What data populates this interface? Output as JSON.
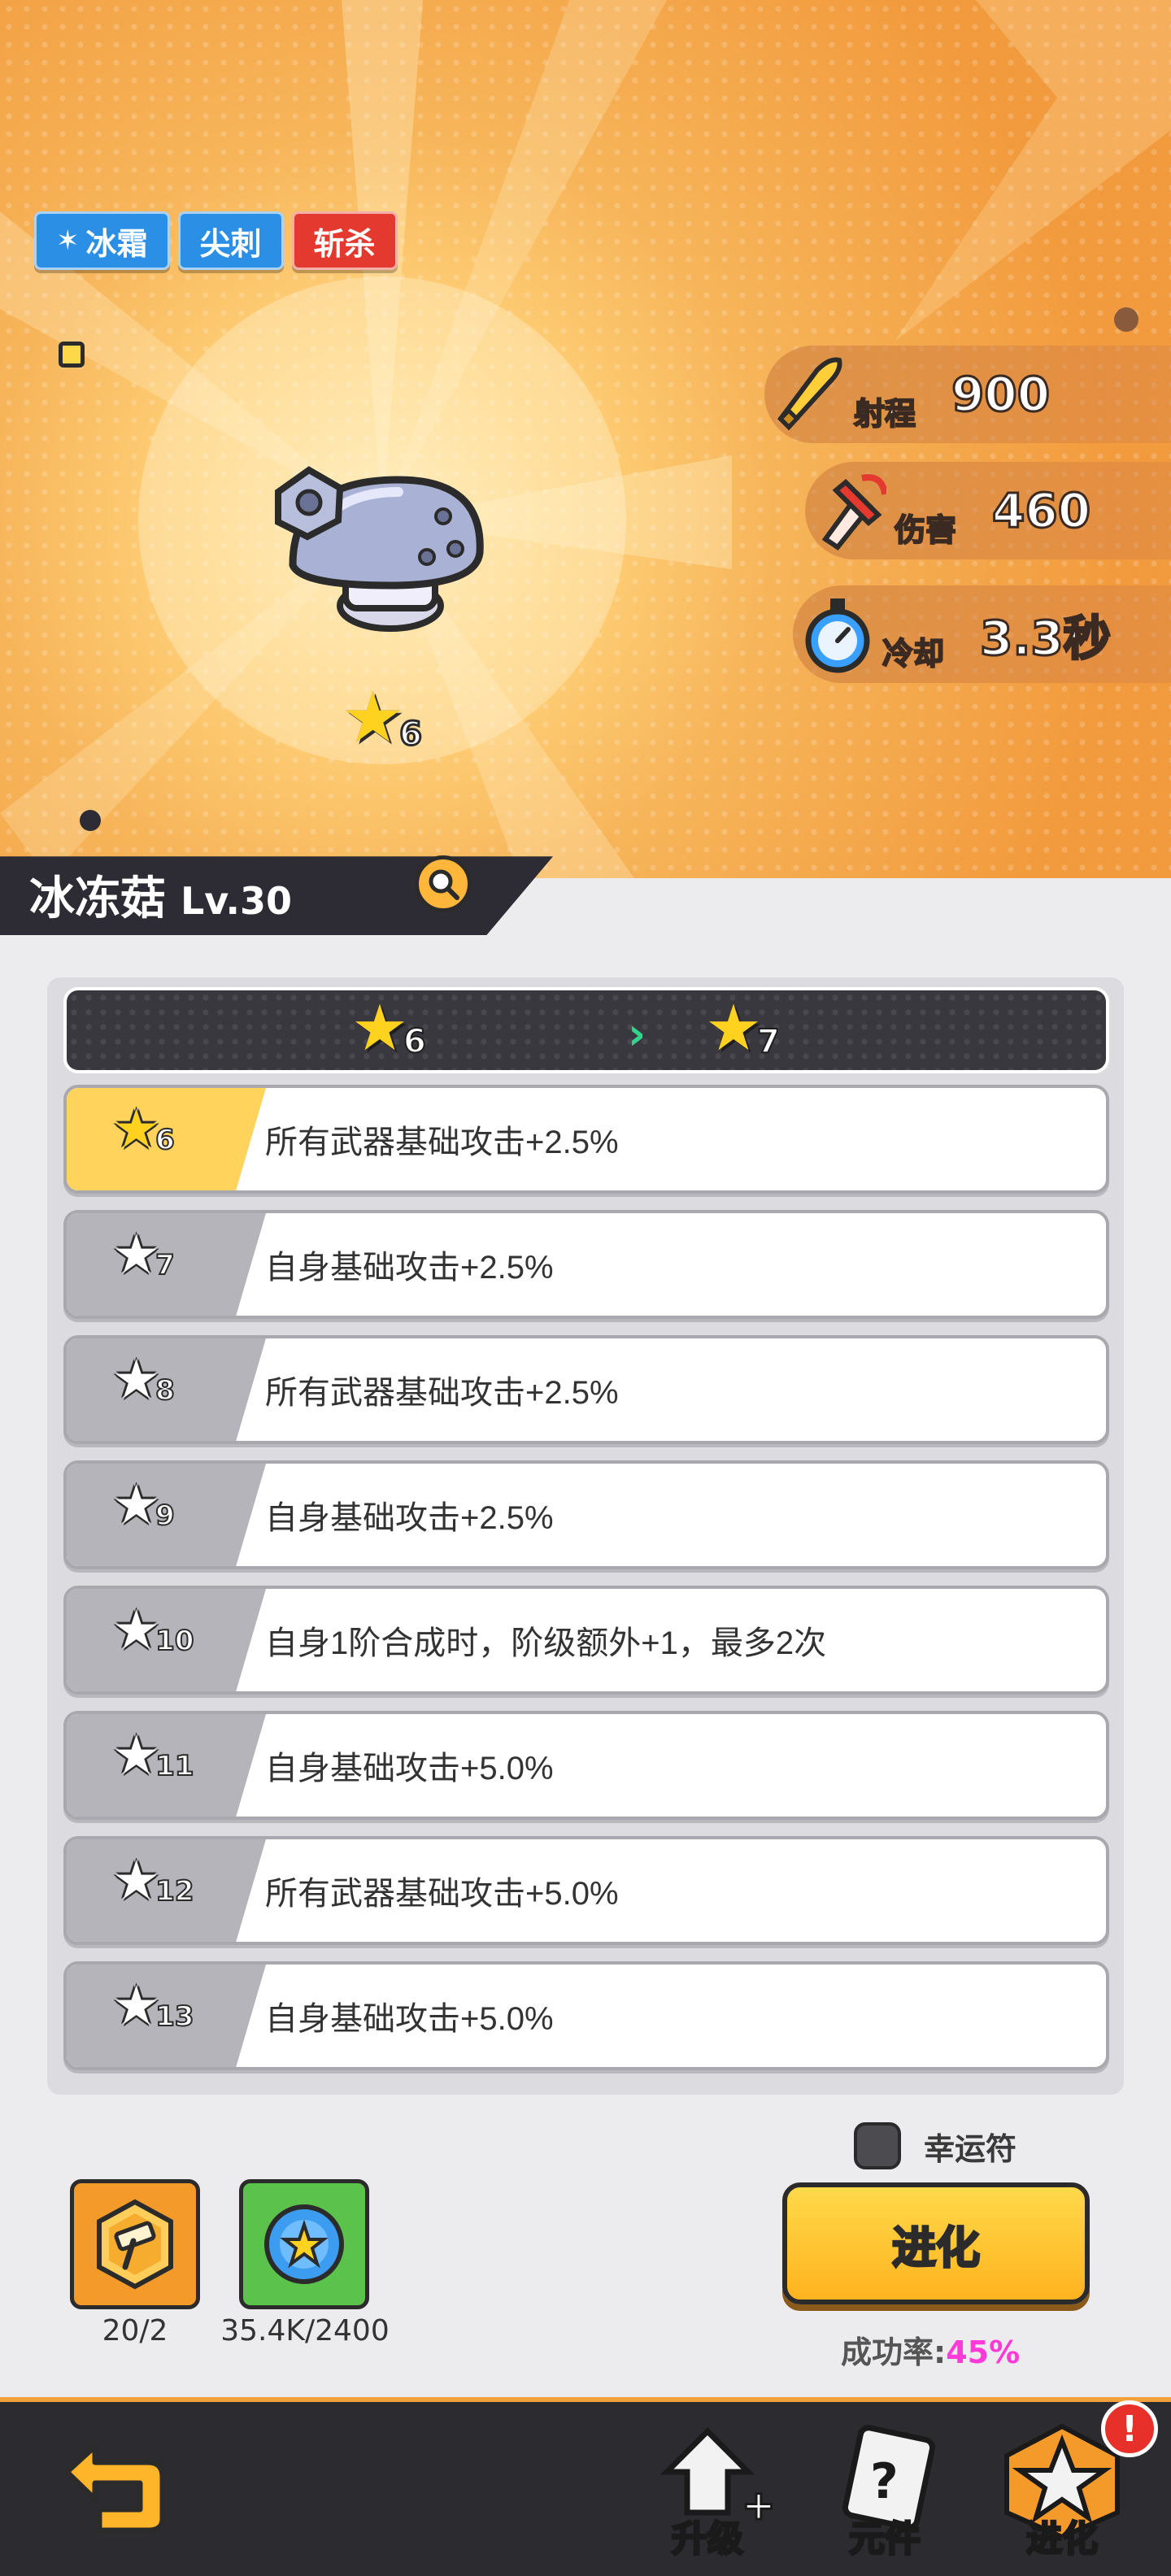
{
  "tags": [
    {
      "label": "冰霜",
      "color": "#2b8fe6"
    },
    {
      "label": "尖刺",
      "color": "#2b8fe6"
    },
    {
      "label": "斩杀",
      "color": "#e3392e"
    }
  ],
  "hero": {
    "star_level": "6",
    "icons": {
      "weapon": "mushroom-helmet-icon",
      "star": "star-icon"
    }
  },
  "stats": [
    {
      "label": "射程",
      "value": "900",
      "icon": "bullet-icon"
    },
    {
      "label": "伤害",
      "value": "460",
      "icon": "sword-icon"
    },
    {
      "label": "冷却",
      "value": "3.3秒",
      "icon": "stopwatch-icon"
    }
  ],
  "item": {
    "name": "冰冻菇",
    "level": "Lv.30"
  },
  "progress": {
    "from": "6",
    "to": "7"
  },
  "star_rows": [
    {
      "star": "6",
      "text": "所有武器基础攻击+2.5%",
      "active": true
    },
    {
      "star": "7",
      "text": "自身基础攻击+2.5%",
      "active": false
    },
    {
      "star": "8",
      "text": "所有武器基础攻击+2.5%",
      "active": false
    },
    {
      "star": "9",
      "text": "自身基础攻击+2.5%",
      "active": false
    },
    {
      "star": "10",
      "text": "自身1阶合成时，阶级额外+1，最多2次",
      "active": false
    },
    {
      "star": "11",
      "text": "自身基础攻击+5.0%",
      "active": false
    },
    {
      "star": "12",
      "text": "所有武器基础攻击+5.0%",
      "active": false
    },
    {
      "star": "13",
      "text": "自身基础攻击+5.0%",
      "active": false
    }
  ],
  "resources": [
    {
      "icon": "hammer-icon",
      "count": "20/2"
    },
    {
      "icon": "bottle-cap-icon",
      "count": "35.4K/2400"
    }
  ],
  "luck_label": "幸运符",
  "evolve_label": "进化",
  "success": {
    "label": "成功率:",
    "value": "45%"
  },
  "nav": {
    "upgrade": "升级",
    "components": "元件",
    "evolve": "进化",
    "alert": "!"
  },
  "colors": {
    "accent": "#ffb31f",
    "highlight": "#ff3ad8",
    "nav_bg": "#2c2b30"
  }
}
